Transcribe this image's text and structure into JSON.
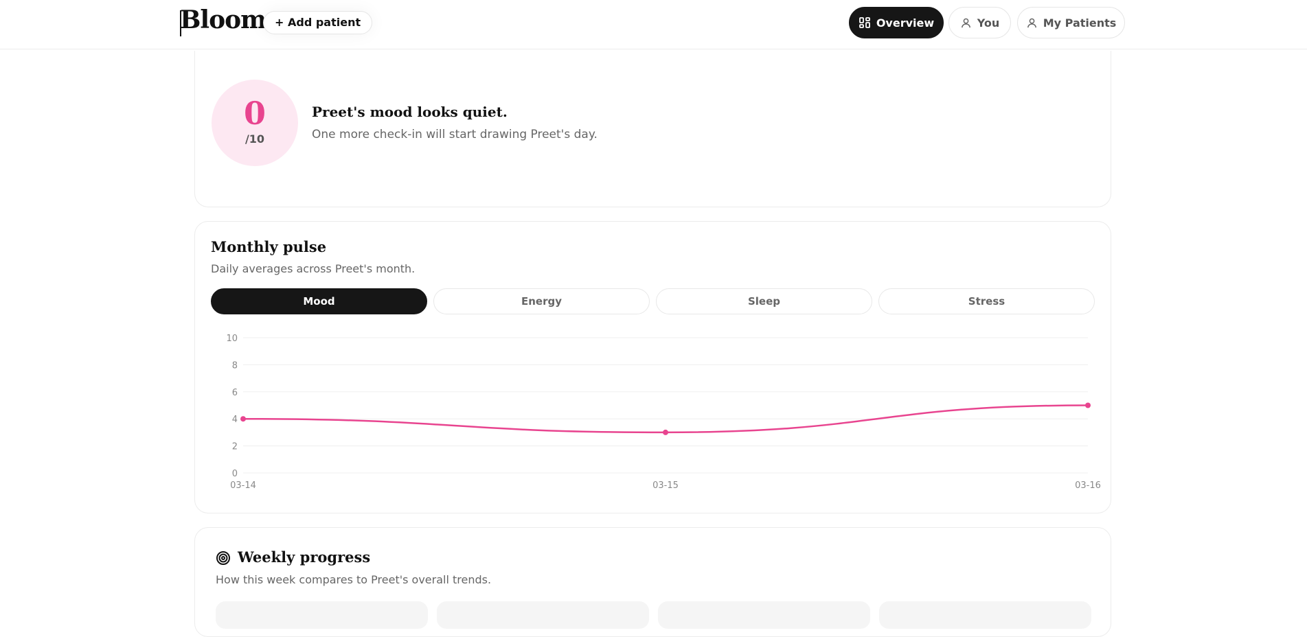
{
  "header": {
    "logo": "Bloom",
    "add_patient": "+ Add patient",
    "nav": [
      {
        "label": "Overview",
        "icon": "dashboard-icon",
        "active": true
      },
      {
        "label": "You",
        "icon": "user-icon",
        "active": false
      },
      {
        "label": "My Patients",
        "icon": "user-icon",
        "active": false
      }
    ]
  },
  "mood_card": {
    "score": "0",
    "scale": "/10",
    "title": "Preet's mood looks quiet.",
    "subtitle": "One more check-in will start drawing Preet's day."
  },
  "monthly_pulse": {
    "title": "Monthly pulse",
    "subtitle": "Daily averages across Preet's month.",
    "tabs": [
      {
        "label": "Mood",
        "active": true
      },
      {
        "label": "Energy",
        "active": false
      },
      {
        "label": "Sleep",
        "active": false
      },
      {
        "label": "Stress",
        "active": false
      }
    ]
  },
  "chart_data": {
    "type": "line",
    "title": "",
    "xlabel": "",
    "ylabel": "",
    "x": [
      "03-14",
      "03-15",
      "03-16"
    ],
    "series": [
      {
        "values": [
          4,
          3,
          5
        ],
        "color": "#e8448f"
      }
    ],
    "ylim": [
      0,
      10
    ],
    "yticks": [
      0,
      2,
      4,
      6,
      8,
      10
    ],
    "grid": true,
    "legend": "none"
  },
  "weekly_progress": {
    "title": "Weekly progress",
    "subtitle": "How this week compares to Preet's overall trends.",
    "icon": "target-icon"
  },
  "colors": {
    "accent": "#e8448f",
    "accent_soft": "#fde8f2",
    "dark": "#161616"
  }
}
